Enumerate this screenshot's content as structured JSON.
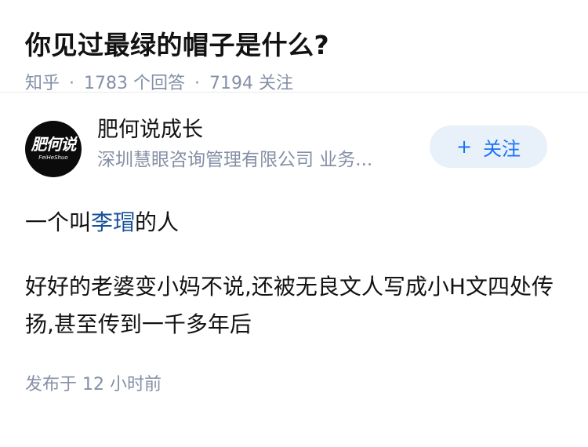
{
  "question": {
    "title": "你见过最绿的帽子是什么?",
    "source": "知乎",
    "answer_count": "1783 个回答",
    "follower_count": "7194 关注",
    "separator": "·"
  },
  "author": {
    "name": "肥何说成长",
    "bio": "深圳慧眼咨询管理有限公司 业务...",
    "avatar_logo": "肥何说",
    "avatar_logo_sub": "FeiHeShuo",
    "follow_label": "关注",
    "follow_icon": "plus-icon"
  },
  "answer": {
    "p1_prefix": "一个叫",
    "p1_link": "李瑁",
    "p1_suffix": "的人",
    "p2": "好好的老婆变小妈不说,还被无良文人写成小H文四处传扬,甚至传到一千多年后",
    "published": "发布于 12 小时前"
  },
  "colors": {
    "link": "#175199",
    "follow_text": "#1772f6",
    "follow_bg": "#e8f0fa",
    "meta_gray": "#8590a6"
  }
}
